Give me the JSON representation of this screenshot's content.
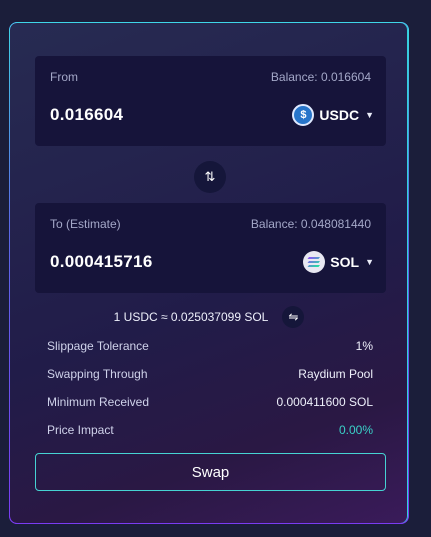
{
  "from": {
    "label": "From",
    "balance": "Balance: 0.016604",
    "amount": "0.016604",
    "token": "USDC",
    "token_icon": "usdc-coin-icon"
  },
  "swap_direction_icon": "swap-vertical-icon",
  "to": {
    "label": "To (Estimate)",
    "balance": "Balance: 0.048081440",
    "amount": "0.000415716",
    "token": "SOL",
    "token_icon": "sol-coin-icon"
  },
  "rate": {
    "text": "1 USDC ≈ 0.025037099 SOL",
    "toggle_icon": "swap-horizontal-icon"
  },
  "details": [
    {
      "label": "Slippage Tolerance",
      "value": "1%"
    },
    {
      "label": "Swapping Through",
      "value": "Raydium Pool"
    },
    {
      "label": "Minimum Received",
      "value": "0.000411600 SOL"
    },
    {
      "label": "Price Impact",
      "value": "0.00%"
    }
  ],
  "swap_button": "Swap",
  "colors": {
    "accent_teal": "#3ad1c8",
    "border_purple": "#7b3cf0",
    "panel_bg": "#16143a"
  }
}
